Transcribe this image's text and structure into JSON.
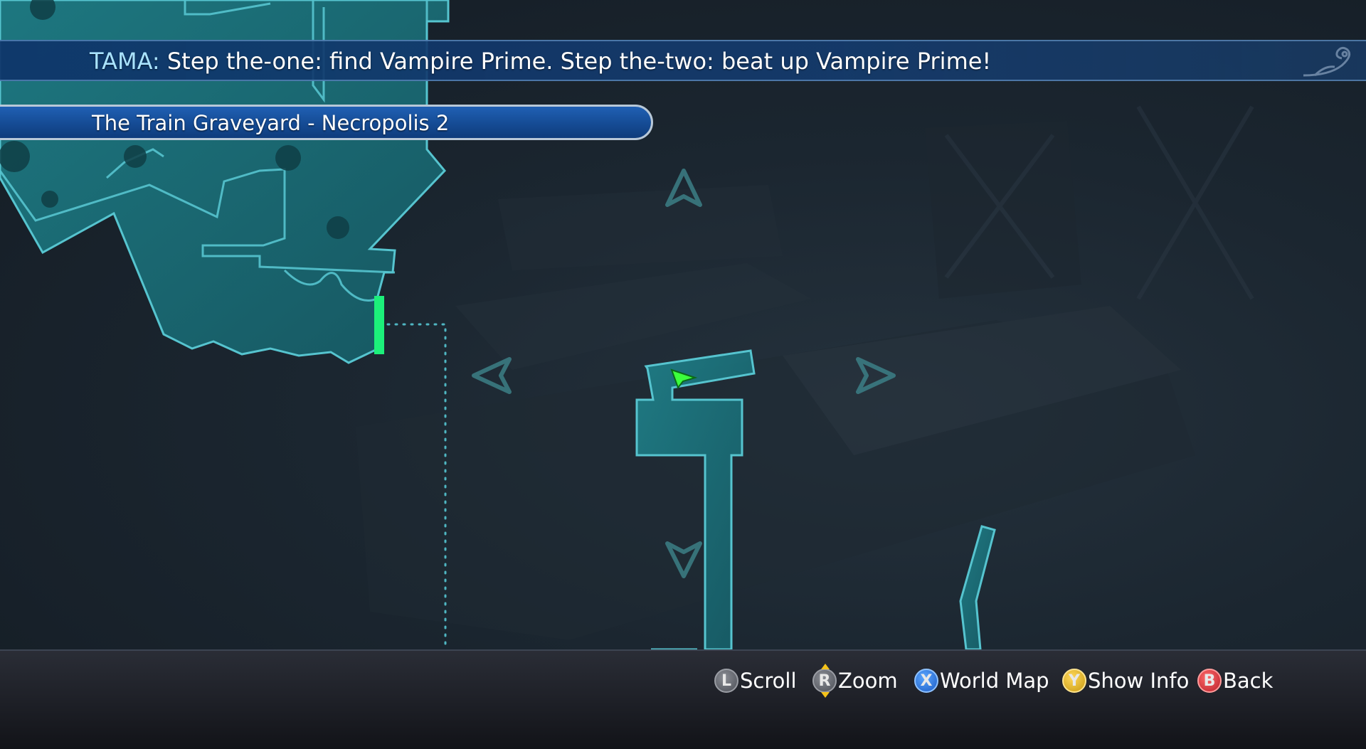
{
  "dialogue": {
    "speaker": "TAMA:",
    "text": " Step the-one: find Vampire Prime. Step the-two: beat up Vampire Prime!"
  },
  "location": {
    "name": "The Train Graveyard - Necropolis 2"
  },
  "map": {
    "scroll_arrows": [
      "up-arrow-icon",
      "down-arrow-icon",
      "left-arrow-icon",
      "right-arrow-icon"
    ],
    "player_marker": "player-cursor-icon",
    "exit_marker": "area-exit-marker",
    "colors": {
      "area_fill": "#1e7a84",
      "area_stroke": "#56c4cf",
      "exit_green": "#1cf07a",
      "player_green": "#3cff3c"
    }
  },
  "controls": [
    {
      "button": "L",
      "label": "Scroll",
      "color": "#6b6e76"
    },
    {
      "button": "R",
      "label": "Zoom",
      "color": "#6b6e76"
    },
    {
      "button": "X",
      "label": "World Map",
      "color": "#2f7be6"
    },
    {
      "button": "Y",
      "label": "Show Info",
      "color": "#e4b52a"
    },
    {
      "button": "B",
      "label": "Back",
      "color": "#d33a44"
    }
  ]
}
